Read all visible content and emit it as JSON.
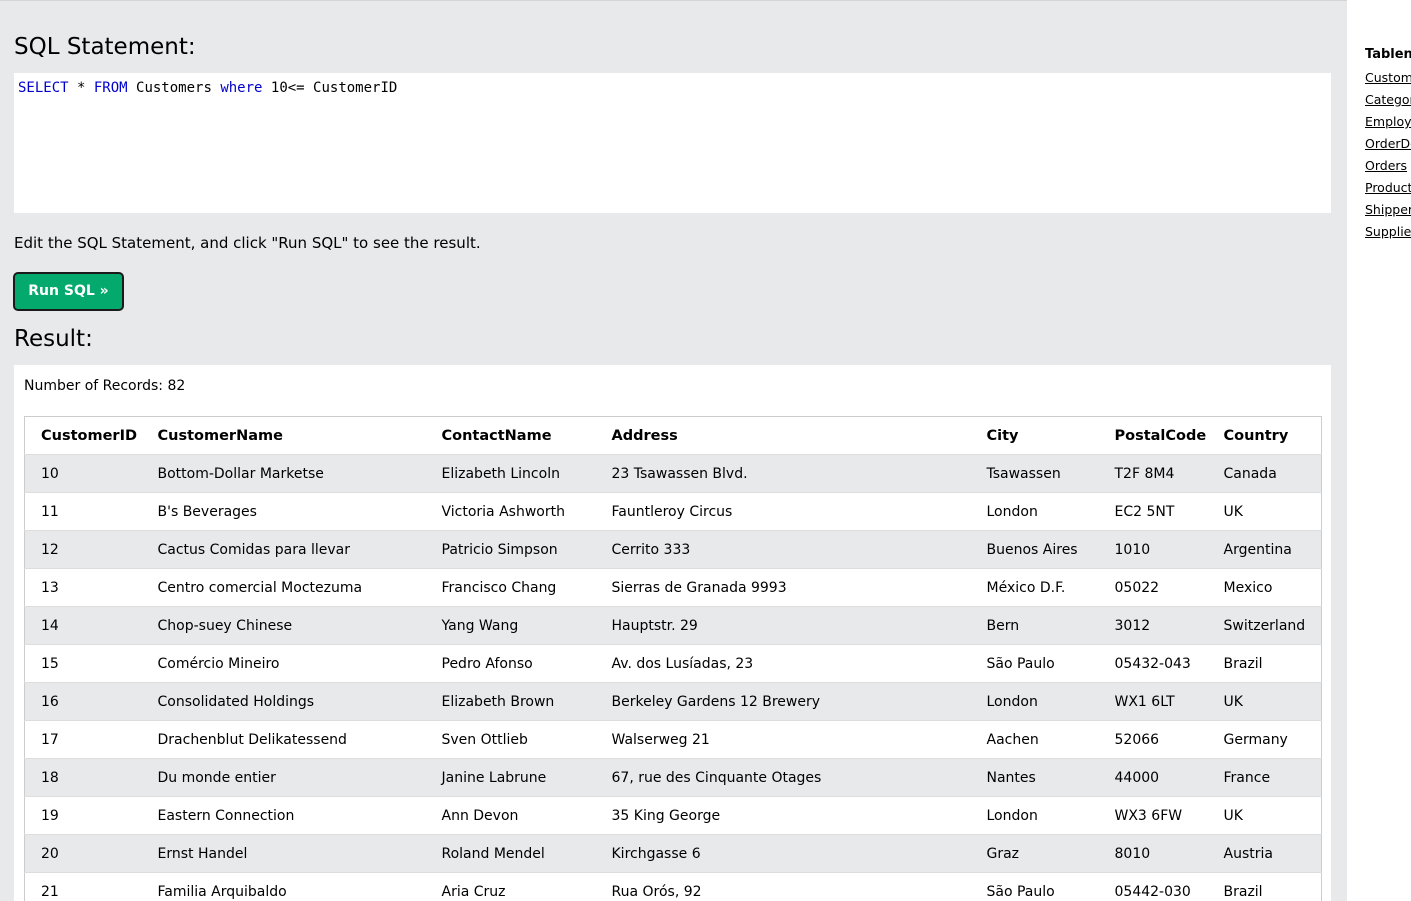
{
  "editor": {
    "heading": "SQL Statement:",
    "query_tokens": [
      {
        "text": "SELECT",
        "kw": true
      },
      {
        "text": " * ",
        "kw": false
      },
      {
        "text": "FROM",
        "kw": true
      },
      {
        "text": " Customers ",
        "kw": false
      },
      {
        "text": "where",
        "kw": true
      },
      {
        "text": " 10<= CustomerID",
        "kw": false
      }
    ]
  },
  "instructions": "Edit the SQL Statement, and click \"Run SQL\" to see the result.",
  "run_button_label": "Run SQL »",
  "result": {
    "heading": "Result:",
    "records_label": "Number of Records: 82",
    "columns": [
      "CustomerID",
      "CustomerName",
      "ContactName",
      "Address",
      "City",
      "PostalCode",
      "Country"
    ],
    "rows": [
      [
        "10",
        "Bottom-Dollar Marketse",
        "Elizabeth Lincoln",
        "23 Tsawassen Blvd.",
        "Tsawassen",
        "T2F 8M4",
        "Canada"
      ],
      [
        "11",
        "B's Beverages",
        "Victoria Ashworth",
        "Fauntleroy Circus",
        "London",
        "EC2 5NT",
        "UK"
      ],
      [
        "12",
        "Cactus Comidas para llevar",
        "Patricio Simpson",
        "Cerrito 333",
        "Buenos Aires",
        "1010",
        "Argentina"
      ],
      [
        "13",
        "Centro comercial Moctezuma",
        "Francisco Chang",
        "Sierras de Granada 9993",
        "México D.F.",
        "05022",
        "Mexico"
      ],
      [
        "14",
        "Chop-suey Chinese",
        "Yang Wang",
        "Hauptstr. 29",
        "Bern",
        "3012",
        "Switzerland"
      ],
      [
        "15",
        "Comércio Mineiro",
        "Pedro Afonso",
        "Av. dos Lusíadas, 23",
        "São Paulo",
        "05432-043",
        "Brazil"
      ],
      [
        "16",
        "Consolidated Holdings",
        "Elizabeth Brown",
        "Berkeley Gardens 12 Brewery",
        "London",
        "WX1 6LT",
        "UK"
      ],
      [
        "17",
        "Drachenblut Delikatessend",
        "Sven Ottlieb",
        "Walserweg 21",
        "Aachen",
        "52066",
        "Germany"
      ],
      [
        "18",
        "Du monde entier",
        "Janine Labrune",
        "67, rue des Cinquante Otages",
        "Nantes",
        "44000",
        "France"
      ],
      [
        "19",
        "Eastern Connection",
        "Ann Devon",
        "35 King George",
        "London",
        "WX3 6FW",
        "UK"
      ],
      [
        "20",
        "Ernst Handel",
        "Roland Mendel",
        "Kirchgasse 6",
        "Graz",
        "8010",
        "Austria"
      ],
      [
        "21",
        "Familia Arquibaldo",
        "Aria Cruz",
        "Rua Orós, 92",
        "São Paulo",
        "05442-030",
        "Brazil"
      ]
    ]
  },
  "sidebar": {
    "title": "Tablen",
    "items": [
      "Custom",
      "Categor",
      "Employe",
      "OrderDe",
      "Orders",
      "Product",
      "Shipper",
      "Supplier"
    ]
  },
  "colors": {
    "button": "#04aa6d",
    "keyword": "#0000cd",
    "panel_bg": "#e7e9eb"
  }
}
